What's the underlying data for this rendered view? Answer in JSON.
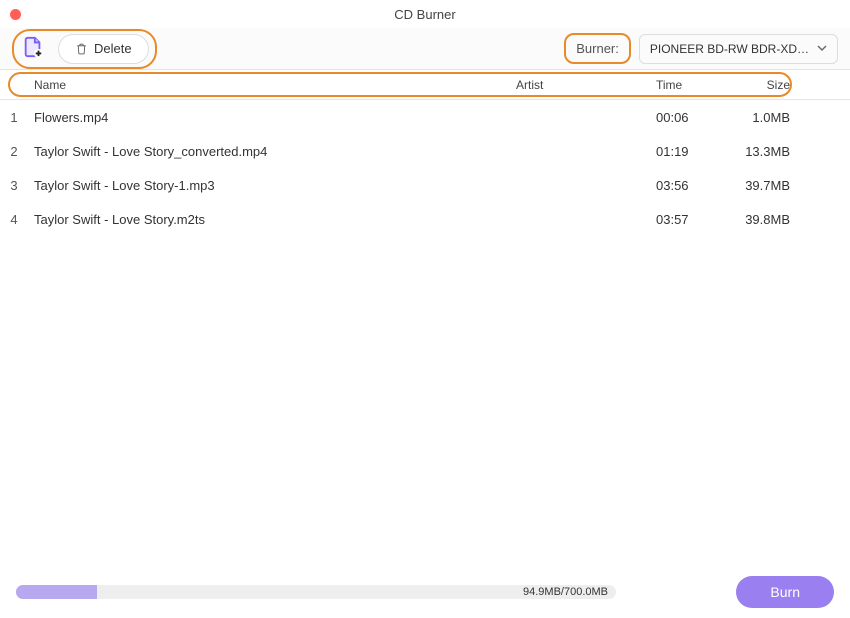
{
  "window": {
    "title": "CD Burner"
  },
  "toolbar": {
    "delete_label": "Delete",
    "burner_label": "Burner:",
    "burner_selected": "PIONEER BD-RW BDR-XD…"
  },
  "columns": {
    "name": "Name",
    "artist": "Artist",
    "time": "Time",
    "size": "Size"
  },
  "rows": [
    {
      "idx": "1",
      "name": "Flowers.mp4",
      "artist": "",
      "time": "00:06",
      "size": "1.0MB"
    },
    {
      "idx": "2",
      "name": "Taylor Swift - Love Story_converted.mp4",
      "artist": "",
      "time": "01:19",
      "size": "13.3MB"
    },
    {
      "idx": "3",
      "name": "Taylor Swift - Love Story-1.mp3",
      "artist": "",
      "time": "03:56",
      "size": "39.7MB"
    },
    {
      "idx": "4",
      "name": "Taylor Swift - Love Story.m2ts",
      "artist": "",
      "time": "03:57",
      "size": "39.8MB"
    }
  ],
  "footer": {
    "progress_text": "94.9MB/700.0MB",
    "burn_label": "Burn"
  }
}
